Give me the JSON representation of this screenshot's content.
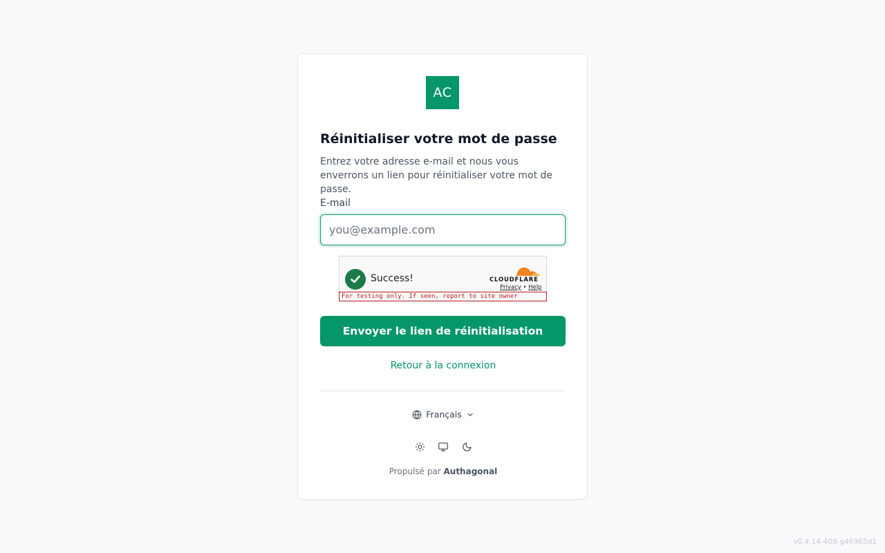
{
  "logo": {
    "text": "AC",
    "color": "#059669"
  },
  "title": "Réinitialiser votre mot de passe",
  "description": "Entrez votre adresse e-mail et nous vous enverrons un lien pour réinitialiser votre mot de passe.",
  "form": {
    "email_label": "E-mail",
    "email_placeholder": "you@example.com",
    "email_value": ""
  },
  "captcha": {
    "status": "Success!",
    "provider": "CLOUDFLARE",
    "privacy_link": "Privacy",
    "separator": "•",
    "help_link": "Help",
    "warning": "For testing only. If seen, report to site owner"
  },
  "submit_label": "Envoyer le lien de réinitialisation",
  "back_link": "Retour à la connexion",
  "language": {
    "selected": "Français",
    "icon": "globe-icon"
  },
  "theme": {
    "options": [
      {
        "name": "light",
        "icon": "sun-icon"
      },
      {
        "name": "system",
        "icon": "monitor-icon"
      },
      {
        "name": "dark",
        "icon": "moon-icon"
      }
    ]
  },
  "footer": {
    "powered_prefix": "Propulsé par",
    "powered_brand": "Authagonal"
  },
  "version": "v0.4.14-408-g46965d1",
  "colors": {
    "accent": "#059669",
    "background": "#f8fafc",
    "captcha_success": "#1c7c49",
    "warning": "#b91c1c"
  }
}
